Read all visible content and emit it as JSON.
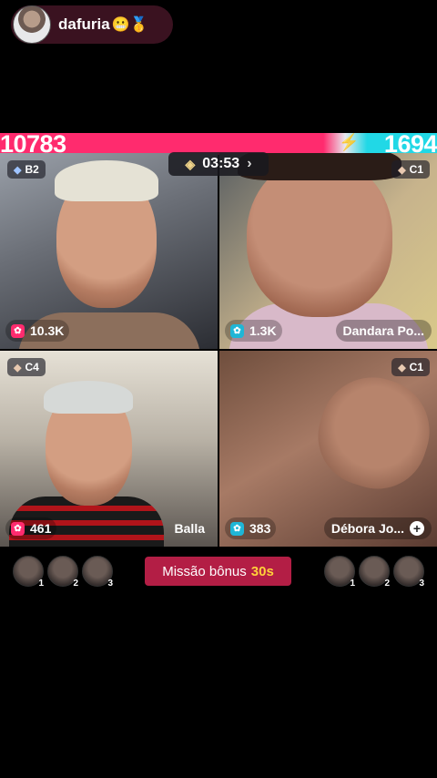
{
  "host": {
    "name": "dafuria",
    "emoji": "😬🥇"
  },
  "battle": {
    "score_left": "10783",
    "score_right": "1694",
    "timer": "03:53"
  },
  "players": [
    {
      "rank": "B2",
      "count": "10.3K",
      "count_color": "#ff2b6e",
      "name": ""
    },
    {
      "rank": "C1",
      "count": "1.3K",
      "count_color": "#1fb6d6",
      "name": "Dandara Po..."
    },
    {
      "rank": "C4",
      "count": "461",
      "count_color": "#ff2b6e",
      "name": "Balla"
    },
    {
      "rank": "C1",
      "count": "383",
      "count_color": "#1fb6d6",
      "name": "Débora Jo..."
    }
  ],
  "bottom": {
    "mission_label": "Missão bônus",
    "mission_time": "30s",
    "left_viewer_ranks": [
      "1",
      "2",
      "3"
    ],
    "right_viewer_ranks": [
      "1",
      "2",
      "3"
    ]
  },
  "icons": {
    "gem": "diamond-icon",
    "coin": "gift-icon",
    "plus": "plus-icon",
    "chevron": "chevron-right-icon"
  },
  "colors": {
    "team_pink": "#ff2b6e",
    "team_cyan": "#21d8e6",
    "mission_bg": "#b31e45",
    "mission_accent": "#ffd23a"
  }
}
